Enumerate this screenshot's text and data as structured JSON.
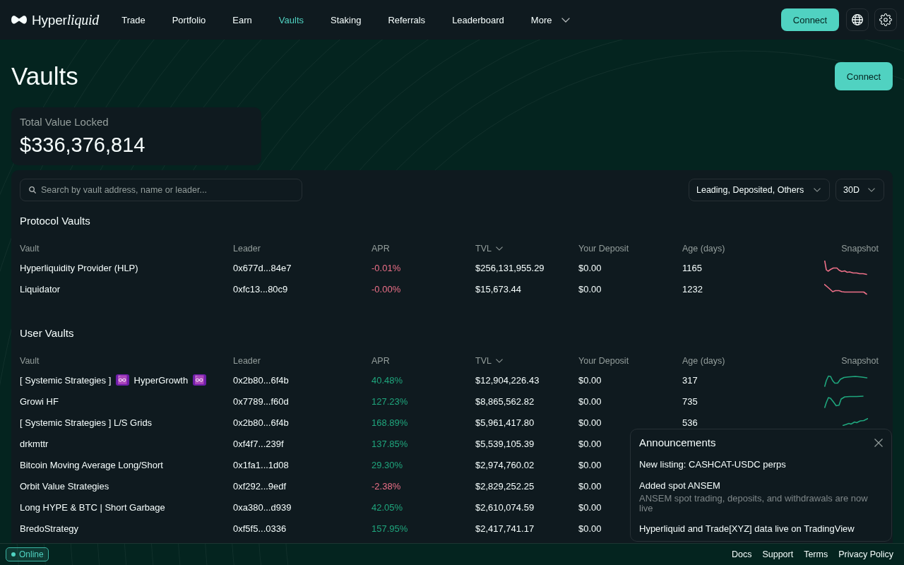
{
  "nav": {
    "logo": {
      "text": "Hyper",
      "italic_text": "liquid"
    },
    "items": [
      {
        "label": "Trade",
        "selected": false,
        "kind": "link"
      },
      {
        "label": "Portfolio",
        "selected": false,
        "kind": "link"
      },
      {
        "label": "Earn",
        "selected": false,
        "kind": "link"
      },
      {
        "label": "Vaults",
        "selected": true,
        "kind": "link"
      },
      {
        "label": "Staking",
        "selected": false,
        "kind": "link"
      },
      {
        "label": "Referrals",
        "selected": false,
        "kind": "link"
      },
      {
        "label": "Leaderboard",
        "selected": false,
        "kind": "link"
      },
      {
        "label": "More",
        "selected": false,
        "kind": "menu"
      }
    ],
    "connect_button": "Connect"
  },
  "header": {
    "title": "Vaults",
    "connect_button": "Connect"
  },
  "tvl_card": {
    "label": "Total Value Locked",
    "value": "$336,376,814"
  },
  "toolbar": {
    "search": {
      "placeholder": "Search by vault address, name or leader..."
    },
    "dropdowns": [
      {
        "value": "Leading, Deposited, Others"
      },
      {
        "value": "30D"
      }
    ]
  },
  "sections": [
    {
      "title": "Protocol Vaults",
      "columns": [
        {
          "label": "Vault",
          "sorted": false
        },
        {
          "label": "Leader",
          "sorted": false
        },
        {
          "label": "APR",
          "sorted": false
        },
        {
          "label": "TVL",
          "sorted": true
        },
        {
          "label": "Your Deposit",
          "sorted": false
        },
        {
          "label": "Age (days)",
          "sorted": false
        },
        {
          "label": "Snapshot",
          "sorted": false
        }
      ],
      "rows": [
        {
          "vault": "Hyperliquidity Provider (HLP)",
          "leader": "0x677d...84e7",
          "apr": "-0.01%",
          "negative": true,
          "tvl": "$256,131,955.29",
          "deposit": "$0.00",
          "age": "1165",
          "snapshot": true
        },
        {
          "vault": "Liquidator",
          "leader": "0xfc13...80c9",
          "apr": "-0.00%",
          "negative": true,
          "tvl": "$15,673.44",
          "deposit": "$0.00",
          "age": "1232",
          "snapshot": true
        }
      ]
    },
    {
      "title": "User Vaults",
      "columns": [
        {
          "label": "Vault",
          "sorted": false
        },
        {
          "label": "Leader",
          "sorted": false
        },
        {
          "label": "APR",
          "sorted": false
        },
        {
          "label": "TVL",
          "sorted": true
        },
        {
          "label": "Your Deposit",
          "sorted": false
        },
        {
          "label": "Age (days)",
          "sorted": false
        },
        {
          "label": "Snapshot",
          "sorted": false
        }
      ],
      "rows": [
        {
          "vault": "[ Systemic Strategies ] ♾️ HyperGrowth ♾️",
          "leader": "0x2b80...6f4b",
          "apr": "40.48%",
          "negative": false,
          "tvl": "$12,904,226.43",
          "deposit": "$0.00",
          "age": "317",
          "snapshot": true
        },
        {
          "vault": "Growi HF",
          "leader": "0x7789...f60d",
          "apr": "127.23%",
          "negative": false,
          "tvl": "$8,865,562.82",
          "deposit": "$0.00",
          "age": "735",
          "snapshot": true
        },
        {
          "vault": "[ Systemic Strategies ] L/S Grids",
          "leader": "0x2b80...6f4b",
          "apr": "168.89%",
          "negative": false,
          "tvl": "$5,961,417.80",
          "deposit": "$0.00",
          "age": "536",
          "snapshot": true
        },
        {
          "vault": "drkmttr",
          "leader": "0xf4f7...239f",
          "apr": "137.85%",
          "negative": false,
          "tvl": "$5,539,105.39",
          "deposit": "$0.00"
        },
        {
          "vault": "Bitcoin Moving Average Long/Short",
          "leader": "0x1fa1...1d08",
          "apr": "29.30%",
          "negative": false,
          "tvl": "$2,974,760.02",
          "deposit": "$0.00"
        },
        {
          "vault": "Orbit Value Strategies",
          "leader": "0xf292...9edf",
          "apr": "-2.38%",
          "negative": true,
          "tvl": "$2,829,252.25",
          "deposit": "$0.00"
        },
        {
          "vault": "Long HYPE & BTC | Short Garbage",
          "leader": "0xa380...d939",
          "apr": "42.05%",
          "negative": false,
          "tvl": "$2,610,074.59",
          "deposit": "$0.00"
        },
        {
          "vault": "BredoStrategy",
          "leader": "0xf5f5...0336",
          "apr": "157.95%",
          "negative": false,
          "tvl": "$2,417,741.17",
          "deposit": "$0.00"
        }
      ]
    }
  ],
  "status_badge": {
    "label": "Online"
  },
  "footer_links": [
    "Docs",
    "Support",
    "Terms",
    "Privacy Policy"
  ],
  "announcements": {
    "title": "Announcements",
    "items": [
      {
        "title": "New listing: CASHCAT-USDC perps"
      },
      {
        "title": "Added spot ANSEM",
        "body": "ANSEM spot trading, deposits, and withdrawals are now live"
      },
      {
        "title": "Hyperliquid and Trade[XYZ] data live on TradingView"
      }
    ]
  }
}
